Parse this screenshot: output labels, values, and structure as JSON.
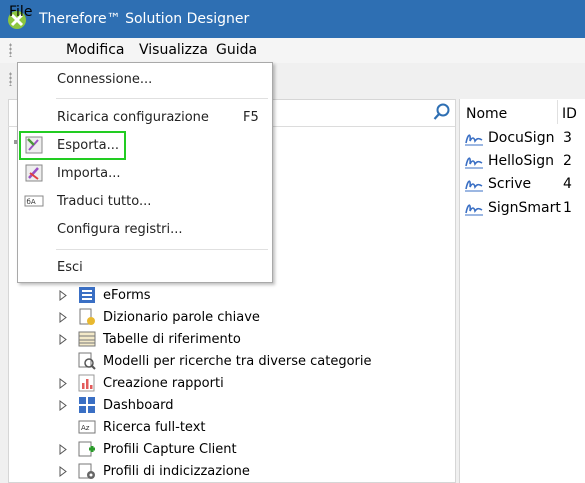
{
  "window": {
    "title": "Therefore™ Solution Designer"
  },
  "menubar": {
    "items": [
      "File",
      "Modifica",
      "Visualizza",
      "Guida"
    ]
  },
  "file_menu": {
    "items": [
      {
        "label": "Connessione...",
        "shortcut": ""
      },
      {
        "label": "Ricarica configurazione",
        "shortcut": "F5"
      },
      {
        "label": "Esporta...",
        "shortcut": "",
        "icon": "export-icon"
      },
      {
        "label": "Importa...",
        "shortcut": "",
        "icon": "import-icon"
      },
      {
        "label": "Traduci tutto...",
        "shortcut": "",
        "icon": "translate-icon"
      },
      {
        "label": "Configura registri...",
        "shortcut": ""
      },
      {
        "label": "Esci",
        "shortcut": ""
      }
    ]
  },
  "tree": {
    "items": [
      {
        "label": "eForms",
        "expandable": true,
        "icon": "eforms-icon"
      },
      {
        "label": "Dizionario parole chiave",
        "expandable": true,
        "icon": "dictionary-icon"
      },
      {
        "label": "Tabelle di riferimento",
        "expandable": true,
        "icon": "table-icon"
      },
      {
        "label": "Modelli per ricerche tra diverse categorie",
        "expandable": false,
        "icon": "search-model-icon"
      },
      {
        "label": "Creazione rapporti",
        "expandable": true,
        "icon": "report-icon"
      },
      {
        "label": "Dashboard",
        "expandable": true,
        "icon": "dashboard-icon"
      },
      {
        "label": "Ricerca full-text",
        "expandable": false,
        "icon": "fulltext-icon"
      },
      {
        "label": "Profili Capture Client",
        "expandable": true,
        "icon": "capture-icon"
      },
      {
        "label": "Profili di indicizzazione",
        "expandable": true,
        "icon": "indexing-icon"
      }
    ]
  },
  "signatures": {
    "columns": {
      "name": "Nome",
      "id": "ID"
    },
    "rows": [
      {
        "name": "DocuSign",
        "id": "3"
      },
      {
        "name": "HelloSign",
        "id": "2"
      },
      {
        "name": "Scrive",
        "id": "4"
      },
      {
        "name": "SignSmart",
        "id": "1"
      }
    ]
  },
  "colors": {
    "titlebar": "#2e6fb3",
    "highlight": "#22cc22",
    "icon_blue": "#3a6fc4"
  }
}
